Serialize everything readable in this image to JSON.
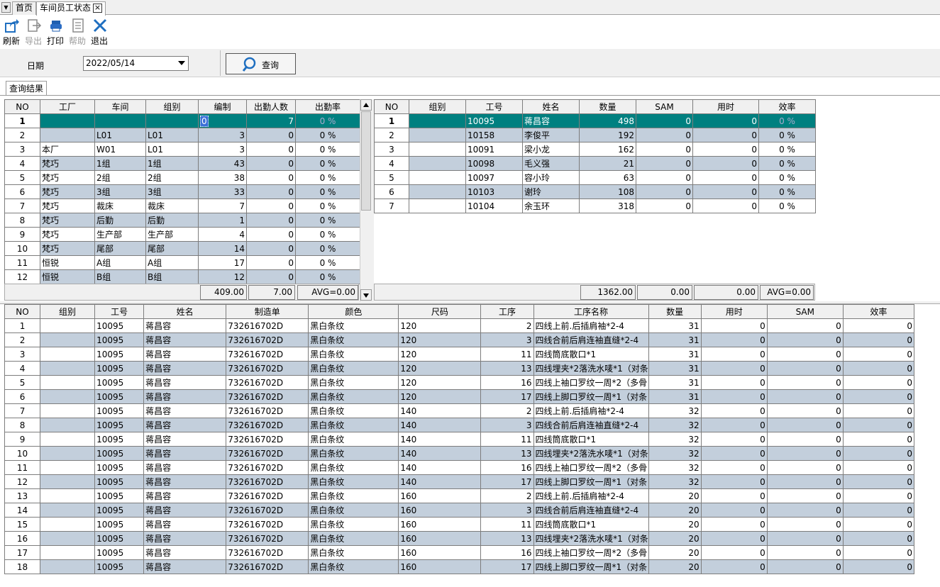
{
  "tabs": [
    {
      "label": "首页"
    },
    {
      "label": "车间员工状态",
      "close": "×"
    }
  ],
  "toolbar": {
    "refresh": "刷新",
    "export": "导出",
    "print": "打印",
    "help": "帮助",
    "exit": "退出"
  },
  "filter": {
    "date_label": "日期",
    "date_value": "2022/05/14",
    "query_label": "查询"
  },
  "result_tab": "查询结果",
  "left_grid": {
    "headers": [
      "NO",
      "工厂",
      "车间",
      "组别",
      "编制",
      "出勤人数",
      "出勤率"
    ],
    "rows": [
      [
        "1",
        "",
        "",
        "",
        "0",
        "7",
        "0 %"
      ],
      [
        "2",
        "",
        "L01",
        "L01",
        "3",
        "0",
        "0 %"
      ],
      [
        "3",
        "本厂",
        "W01",
        "L01",
        "3",
        "0",
        "0 %"
      ],
      [
        "4",
        "梵巧",
        "1组",
        "1组",
        "43",
        "0",
        "0 %"
      ],
      [
        "5",
        "梵巧",
        "2组",
        "2组",
        "38",
        "0",
        "0 %"
      ],
      [
        "6",
        "梵巧",
        "3组",
        "3组",
        "33",
        "0",
        "0 %"
      ],
      [
        "7",
        "梵巧",
        "裁床",
        "裁床",
        "7",
        "0",
        "0 %"
      ],
      [
        "8",
        "梵巧",
        "后勤",
        "后勤",
        "1",
        "0",
        "0 %"
      ],
      [
        "9",
        "梵巧",
        "生产部",
        "生产部",
        "4",
        "0",
        "0 %"
      ],
      [
        "10",
        "梵巧",
        "尾部",
        "尾部",
        "14",
        "0",
        "0 %"
      ],
      [
        "11",
        "恒锐",
        "A组",
        "A组",
        "17",
        "0",
        "0 %"
      ],
      [
        "12",
        "恒锐",
        "B组",
        "B组",
        "12",
        "0",
        "0 %"
      ]
    ],
    "summary": {
      "budget": "409.00",
      "attendance": "7.00",
      "rate": "AVG=0.00"
    }
  },
  "right_grid": {
    "headers": [
      "NO",
      "组别",
      "工号",
      "姓名",
      "数量",
      "SAM",
      "用时",
      "效率"
    ],
    "rows": [
      [
        "1",
        "",
        "10095",
        "蒋昌容",
        "498",
        "0",
        "0",
        "0 %"
      ],
      [
        "2",
        "",
        "10158",
        "李俊平",
        "192",
        "0",
        "0",
        "0 %"
      ],
      [
        "3",
        "",
        "10091",
        "梁小龙",
        "162",
        "0",
        "0",
        "0 %"
      ],
      [
        "4",
        "",
        "10098",
        "毛义强",
        "21",
        "0",
        "0",
        "0 %"
      ],
      [
        "5",
        "",
        "10097",
        "容小玲",
        "63",
        "0",
        "0",
        "0 %"
      ],
      [
        "6",
        "",
        "10103",
        "谢玲",
        "108",
        "0",
        "0",
        "0 %"
      ],
      [
        "7",
        "",
        "10104",
        "余玉环",
        "318",
        "0",
        "0",
        "0 %"
      ]
    ],
    "summary": {
      "qty": "1362.00",
      "sam": "0.00",
      "time": "0.00",
      "rate": "AVG=0.00"
    }
  },
  "bottom_grid": {
    "headers": [
      "NO",
      "组别",
      "工号",
      "姓名",
      "制造单",
      "颜色",
      "尺码",
      "工序",
      "工序名称",
      "数量",
      "用时",
      "SAM",
      "效率"
    ],
    "rows": [
      [
        "1",
        "",
        "10095",
        "蒋昌容",
        "732616702D",
        "黑白条纹",
        "120",
        "2",
        "四线上前.后插肩袖*2-4",
        "31",
        "0",
        "0",
        "0"
      ],
      [
        "2",
        "",
        "10095",
        "蒋昌容",
        "732616702D",
        "黑白条纹",
        "120",
        "3",
        "四线合前后肩连袖直缝*2-4",
        "31",
        "0",
        "0",
        "0"
      ],
      [
        "3",
        "",
        "10095",
        "蒋昌容",
        "732616702D",
        "黑白条纹",
        "120",
        "11",
        "四线筒底散口*1",
        "31",
        "0",
        "0",
        "0"
      ],
      [
        "4",
        "",
        "10095",
        "蒋昌容",
        "732616702D",
        "黑白条纹",
        "120",
        "13",
        "四线埋夹*2落洗水唛*1（对条",
        "31",
        "0",
        "0",
        "0"
      ],
      [
        "5",
        "",
        "10095",
        "蒋昌容",
        "732616702D",
        "黑白条纹",
        "120",
        "16",
        "四线上袖口罗纹一周*2（多骨",
        "31",
        "0",
        "0",
        "0"
      ],
      [
        "6",
        "",
        "10095",
        "蒋昌容",
        "732616702D",
        "黑白条纹",
        "120",
        "17",
        "四线上脚口罗纹一周*1（对条",
        "31",
        "0",
        "0",
        "0"
      ],
      [
        "7",
        "",
        "10095",
        "蒋昌容",
        "732616702D",
        "黑白条纹",
        "140",
        "2",
        "四线上前.后插肩袖*2-4",
        "32",
        "0",
        "0",
        "0"
      ],
      [
        "8",
        "",
        "10095",
        "蒋昌容",
        "732616702D",
        "黑白条纹",
        "140",
        "3",
        "四线合前后肩连袖直缝*2-4",
        "32",
        "0",
        "0",
        "0"
      ],
      [
        "9",
        "",
        "10095",
        "蒋昌容",
        "732616702D",
        "黑白条纹",
        "140",
        "11",
        "四线筒底散口*1",
        "32",
        "0",
        "0",
        "0"
      ],
      [
        "10",
        "",
        "10095",
        "蒋昌容",
        "732616702D",
        "黑白条纹",
        "140",
        "13",
        "四线埋夹*2落洗水唛*1（对条",
        "32",
        "0",
        "0",
        "0"
      ],
      [
        "11",
        "",
        "10095",
        "蒋昌容",
        "732616702D",
        "黑白条纹",
        "140",
        "16",
        "四线上袖口罗纹一周*2（多骨",
        "32",
        "0",
        "0",
        "0"
      ],
      [
        "12",
        "",
        "10095",
        "蒋昌容",
        "732616702D",
        "黑白条纹",
        "140",
        "17",
        "四线上脚口罗纹一周*1（对条",
        "32",
        "0",
        "0",
        "0"
      ],
      [
        "13",
        "",
        "10095",
        "蒋昌容",
        "732616702D",
        "黑白条纹",
        "160",
        "2",
        "四线上前.后插肩袖*2-4",
        "20",
        "0",
        "0",
        "0"
      ],
      [
        "14",
        "",
        "10095",
        "蒋昌容",
        "732616702D",
        "黑白条纹",
        "160",
        "3",
        "四线合前后肩连袖直缝*2-4",
        "20",
        "0",
        "0",
        "0"
      ],
      [
        "15",
        "",
        "10095",
        "蒋昌容",
        "732616702D",
        "黑白条纹",
        "160",
        "11",
        "四线筒底散口*1",
        "20",
        "0",
        "0",
        "0"
      ],
      [
        "16",
        "",
        "10095",
        "蒋昌容",
        "732616702D",
        "黑白条纹",
        "160",
        "13",
        "四线埋夹*2落洗水唛*1（对条",
        "20",
        "0",
        "0",
        "0"
      ],
      [
        "17",
        "",
        "10095",
        "蒋昌容",
        "732616702D",
        "黑白条纹",
        "160",
        "16",
        "四线上袖口罗纹一周*2（多骨",
        "20",
        "0",
        "0",
        "0"
      ],
      [
        "18",
        "",
        "10095",
        "蒋昌容",
        "732616702D",
        "黑白条纹",
        "160",
        "17",
        "四线上脚口罗纹一周*1（对条",
        "20",
        "0",
        "0",
        "0"
      ]
    ]
  },
  "colors": {
    "selected_row": "#008080",
    "alt_row": "#c3cfdc",
    "header_bg": "#f0f0f0"
  }
}
